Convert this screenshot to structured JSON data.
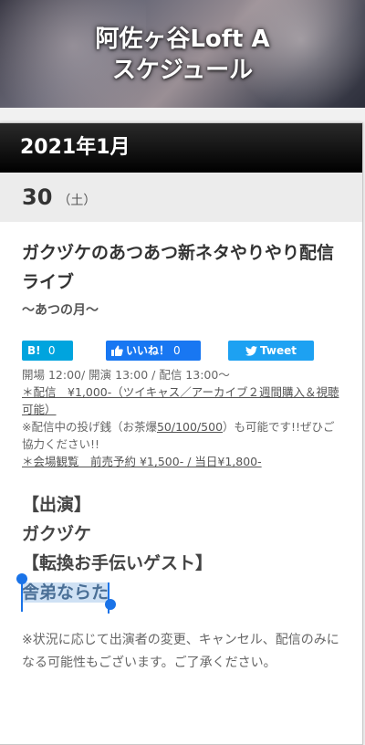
{
  "header": {
    "title_line1": "阿佐ヶ谷Loft A",
    "title_line2": "スケジュール"
  },
  "month": "2021年1月",
  "date": {
    "day": "30",
    "weekday": "（土）"
  },
  "event": {
    "title": "ガクヅケのあつあつ新ネタやりやり配信ライブ",
    "subtitle": "〜あつの月〜",
    "share": {
      "hatena_label": "B!",
      "hatena_count": "0",
      "like_label": "いいね！",
      "like_count": "0",
      "tweet_label": "Tweet"
    },
    "times": "開場 12:00/ 開演 13:00 / 配信 13:00〜",
    "stream_price": "＊配信　¥1,000-（ツイキャス／アーカイブ２週間購入＆視聴可能）",
    "tip_prefix": "※配信中の投げ銭（お茶爆",
    "tip_link": "50/100/500",
    "tip_suffix": "）も可能です!!ぜひご協力ください!!",
    "venue_price": "＊会場観覧　前売予約 ¥1,500- / 当日¥1,800-",
    "cast_heading": "【出演】",
    "cast_main": "ガクヅケ",
    "guest_heading": "【転換お手伝いゲスト】",
    "guest_name": "舎弟ならた",
    "notice": "※状況に応じて出演者の変更、キャンセル、配信のみになる可能性もございます。ご了承ください。"
  },
  "colors": {
    "hatena": "#00a4de",
    "facebook": "#1877f2",
    "twitter": "#1da1f2",
    "selection": "#cfe1f4",
    "handle": "#1a73e8"
  },
  "icons": [
    "thumbs-up-icon",
    "twitter-bird-icon",
    "selection-handle-icon"
  ]
}
